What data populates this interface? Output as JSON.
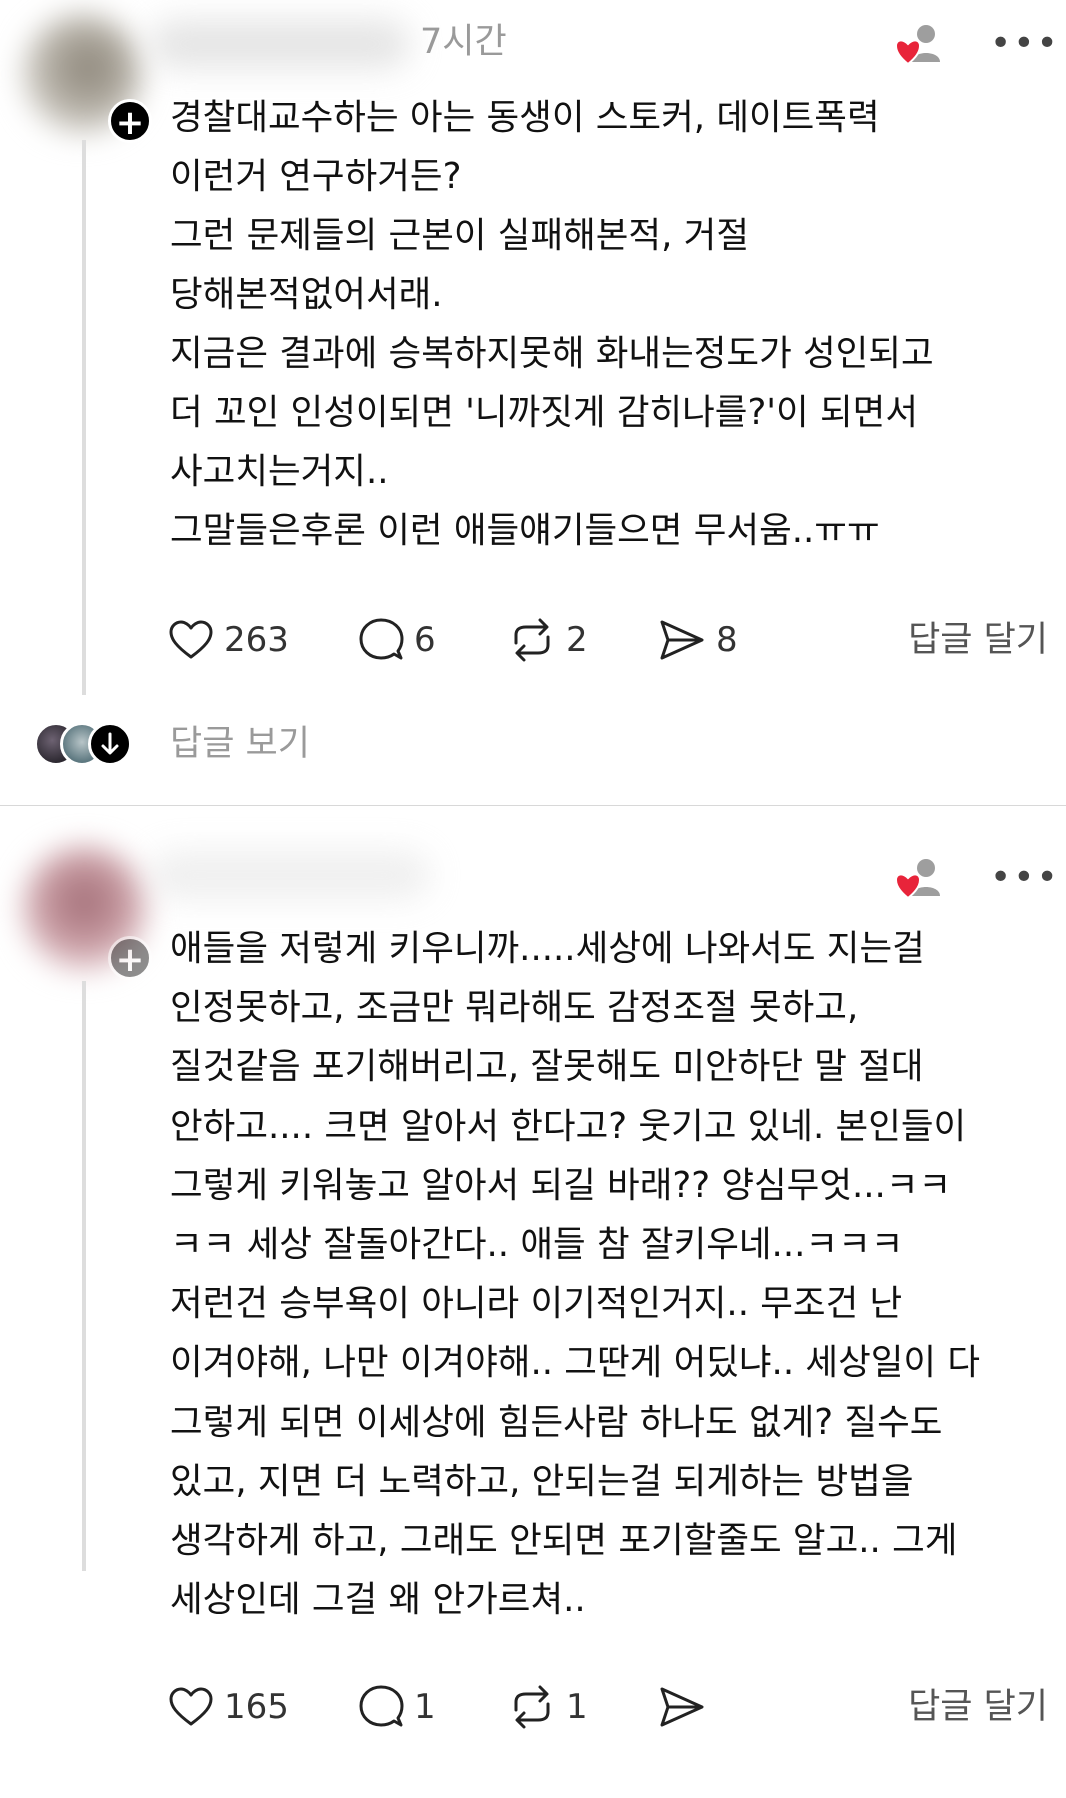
{
  "colors": {
    "heart_red": "#e8243a",
    "text": "#111111",
    "muted": "#9a9a9a"
  },
  "post1": {
    "timestamp": "7시간",
    "lines": [
      "경찰대교수하는 아는 동생이 스토커, 데이트폭력",
      "이런거 연구하거든?",
      "그런 문제들의 근본이 실패해본적, 거절",
      "당해본적없어서래.",
      "지금은 결과에 승복하지못해 화내는정도가 성인되고",
      "더 꼬인 인성이되면 '니까짓게 감히나를?'이 되면서",
      "사고치는거지..",
      "그말들은후론 이런 애들얘기들으면 무서움..ㅠㅠ"
    ],
    "likes": "263",
    "comments": "6",
    "reposts": "2",
    "shares": "8",
    "reply_label": "답글 달기",
    "view_replies": "답글 보기",
    "icons": [
      "plus-icon",
      "follow-heart-icon",
      "more-icon",
      "heart-icon",
      "comment-icon",
      "repost-icon",
      "share-icon",
      "arrow-down-icon"
    ]
  },
  "post2": {
    "lines": [
      "애들을 저렇게 키우니까.....세상에 나와서도 지는걸",
      "인정못하고, 조금만 뭐라해도 감정조절 못하고,",
      "질것같음 포기해버리고, 잘못해도 미안하단 말 절대",
      "안하고.... 크면 알아서 한다고? 웃기고 있네. 본인들이",
      "그렇게 키워놓고 알아서 되길 바래?? 양심무엇...ㅋㅋ",
      "ㅋㅋ 세상 잘돌아간다.. 애들 참 잘키우네...ㅋㅋㅋ",
      "저런건 승부욕이 아니라 이기적인거지.. 무조건 난",
      "이겨야해, 나만 이겨야해.. 그딴게 어딨냐.. 세상일이 다",
      "그렇게 되면 이세상에 힘든사람 하나도 없게? 질수도",
      "있고, 지면 더 노력하고, 안되는걸 되게하는 방법을",
      "생각하게 하고, 그래도 안되면 포기할줄도 알고.. 그게",
      "세상인데 그걸 왜 안가르쳐.."
    ],
    "likes": "165",
    "comments": "1",
    "reposts": "1",
    "reply_label": "답글 달기"
  }
}
